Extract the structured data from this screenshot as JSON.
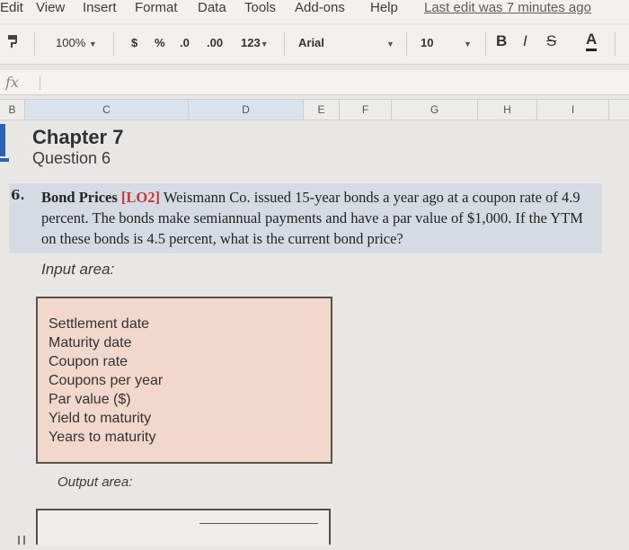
{
  "menu": {
    "items": [
      "Edit",
      "View",
      "Insert",
      "Format",
      "Data",
      "Tools",
      "Add-ons",
      "Help"
    ],
    "last_edit": "Last edit was 7 minutes ago"
  },
  "toolbar": {
    "zoom": "100%",
    "currency": "$",
    "percent": "%",
    "decrease_decimal": ".0",
    "increase_decimal": ".00",
    "more_formats": "123",
    "font": "Arial",
    "font_size": "10",
    "bold": "B",
    "italic": "I",
    "strikethrough": "S",
    "text_color": "A"
  },
  "formula_bar": {
    "fx": "fx"
  },
  "columns": [
    "B",
    "C",
    "D",
    "E",
    "F",
    "G",
    "H",
    "I"
  ],
  "sheet": {
    "chapter": "Chapter 7",
    "question": "Question 6",
    "problem_number": "6.",
    "problem_title": "Bond Prices",
    "problem_lo": "[LO2]",
    "problem_body": "Weismann Co. issued 15-year bonds a year ago at a coupon rate of 4.9 percent. The bonds make semiannual payments and have a par value of $1,000. If the YTM on these bonds is 4.5 percent, what is the current bond price?",
    "input_label": "Input area:",
    "inputs": [
      "Settlement date",
      "Maturity date",
      "Coupon rate",
      "Coupons per year",
      "Par value ($)",
      "Yield to maturity",
      "Years to maturity"
    ],
    "output_label": "Output area:"
  },
  "colors": {
    "input_fill": "#f1d7cc",
    "problem_fill": "#d6dae3",
    "selection_blue": "#2a62b8"
  }
}
